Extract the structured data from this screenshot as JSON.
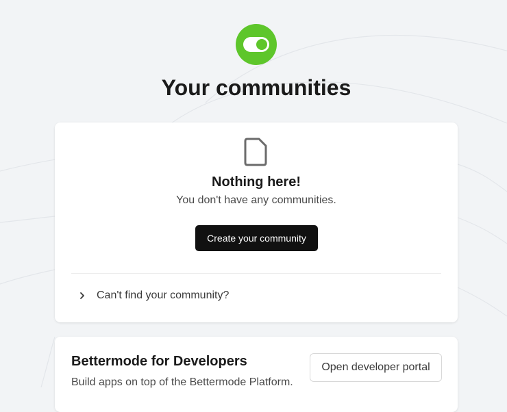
{
  "colors": {
    "brand": "#5ec62b",
    "button_dark": "#111111",
    "background": "#f2f4f6"
  },
  "logo": {
    "icon": "toggle-switch-icon"
  },
  "header": {
    "title": "Your communities"
  },
  "empty_state": {
    "icon": "document-icon",
    "title": "Nothing here!",
    "message": "You don't have any communities.",
    "create_button_label": "Create your community",
    "disclosure_icon": "chevron-right-icon",
    "disclosure_label": "Can't find your community?"
  },
  "developers": {
    "title": "Bettermode for Developers",
    "subtitle": "Build apps on top of the Bettermode Platform.",
    "portal_button_label": "Open developer portal"
  }
}
